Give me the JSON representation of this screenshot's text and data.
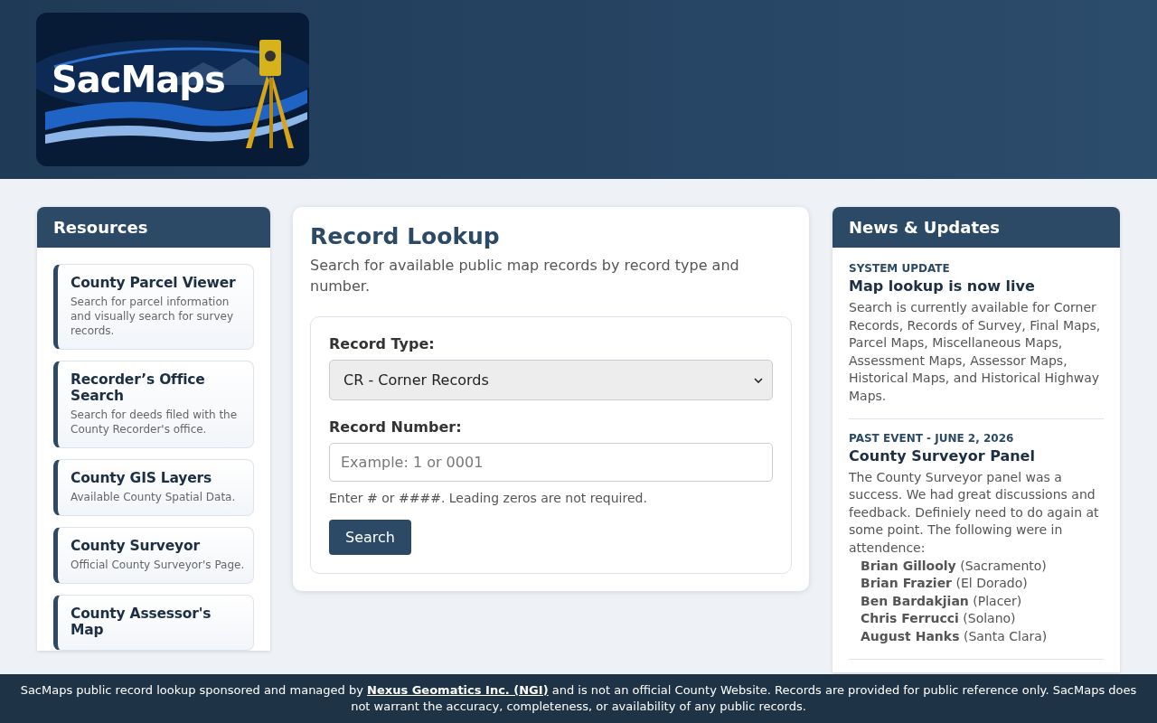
{
  "logo": {
    "text": "SacMaps"
  },
  "resources": {
    "title": "Resources",
    "items": [
      {
        "title": "County Parcel Viewer",
        "description": "Search for parcel information and visually search for survey records."
      },
      {
        "title": "Recorder’s Office Search",
        "description": "Search for deeds filed with the County Recorder's office."
      },
      {
        "title": "County GIS Layers",
        "description": "Available County Spatial Data."
      },
      {
        "title": "County Surveyor",
        "description": "Official County Surveyor's Page."
      },
      {
        "title": "County Assessor's Map"
      }
    ]
  },
  "lookup": {
    "title": "Record Lookup",
    "subtitle": "Search for available public map records by record type and number.",
    "record_type": {
      "label": "Record Type:",
      "value": "CR - Corner Records"
    },
    "record_number": {
      "label": "Record Number:",
      "placeholder": "Example: 1 or 0001"
    },
    "hint": "Enter # or ####. Leading zeros are not required.",
    "button": "Search"
  },
  "news": {
    "title": "News & Updates",
    "items": [
      {
        "tag": "SYSTEM UPDATE",
        "title": "Map lookup is now live",
        "body": "Search is currently available for Corner Records, Records of Survey, Final Maps, Parcel Maps, Miscellaneous Maps, Assessment Maps, Assessor Maps, Historical Maps, and Historical Highway Maps."
      },
      {
        "tag": "PAST EVENT - JUNE 2, 2026",
        "title": "County Surveyor Panel",
        "body": "The County Surveyor panel was a success. We had great discussions and feedback. Definiely need to do again at some point. The following were in attendence:",
        "attendees": [
          "**Brian Gillooly** (Sacramento)",
          "**Brian Frazier** (El Dorado)",
          "**Ben Bardakjian** (Placer)",
          "**Chris Ferrucci** (Solano)",
          "**August Hanks** (Santa Clara)"
        ]
      }
    ]
  },
  "footer": {
    "before": "SacMaps public record lookup sponsored and managed by",
    "link": "Nexus Geomatics Inc. (NGI)",
    "after": "and is not an official County Website. Records are provided for public reference only. SacMaps does not warrant the accuracy, completeness, or availability of any public records."
  }
}
